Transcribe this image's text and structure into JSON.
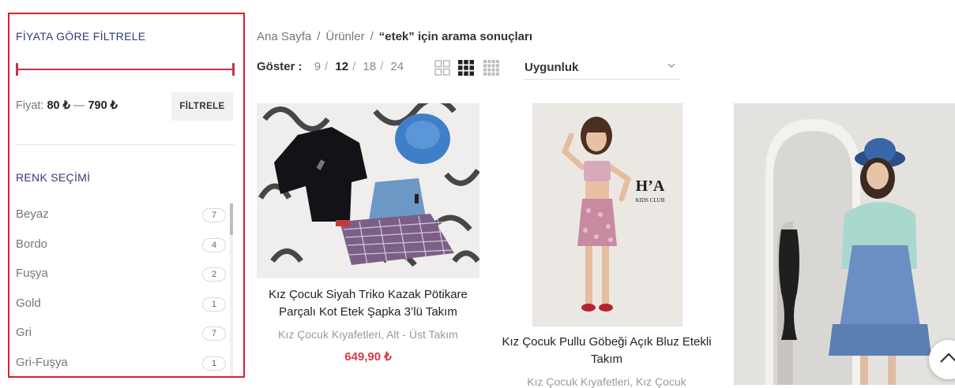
{
  "sidebar": {
    "price_filter_title": "FİYATA GÖRE FİLTRELE",
    "price_label": "Fiyat:",
    "price_min": "80 ₺",
    "price_dash": "—",
    "price_max": "790 ₺",
    "filter_button": "FİLTRELE",
    "color_title": "RENK SEÇİMİ",
    "colors": [
      {
        "name": "Beyaz",
        "count": "7"
      },
      {
        "name": "Bordo",
        "count": "4"
      },
      {
        "name": "Fuşya",
        "count": "2"
      },
      {
        "name": "Gold",
        "count": "1"
      },
      {
        "name": "Gri",
        "count": "7"
      },
      {
        "name": "Gri-Fuşya",
        "count": "1"
      }
    ],
    "accent_color": "#c9304b",
    "highlight_border_color": "#e31e24"
  },
  "breadcrumb": {
    "home": "Ana Sayfa",
    "products": "Ürünler",
    "current": "“etek” için arama sonuçları",
    "separator": "/"
  },
  "toolbar": {
    "show_label": "Göster :",
    "per_page_options": [
      "9",
      "12",
      "18",
      "24"
    ],
    "per_page_selected": "12",
    "views": [
      "grid-2-icon",
      "grid-3-icon",
      "grid-4-icon"
    ],
    "view_selected": "grid-3-icon",
    "sort_selected": "Uygunluk"
  },
  "products": [
    {
      "title": "Kız Çocuk Siyah Triko Kazak Pötikare Parçalı Kot Etek Şapka 3’lü Takım",
      "categories": "Kız Çocuk Kıyafetleri, Alt - Üst Takım",
      "price": "649,90 ₺"
    },
    {
      "title": "Kız Çocuk Pullu Göbeği Açık Bluz Etekli Takım",
      "categories": "Kız Çocuk Kıyafetleri, Kız Çocuk",
      "price": ""
    },
    {
      "title": "",
      "categories": "",
      "price": ""
    }
  ],
  "product_2_logo": {
    "line1": "H’A",
    "line2": "KIDS CLUB"
  },
  "price_color": "#d23c4a"
}
